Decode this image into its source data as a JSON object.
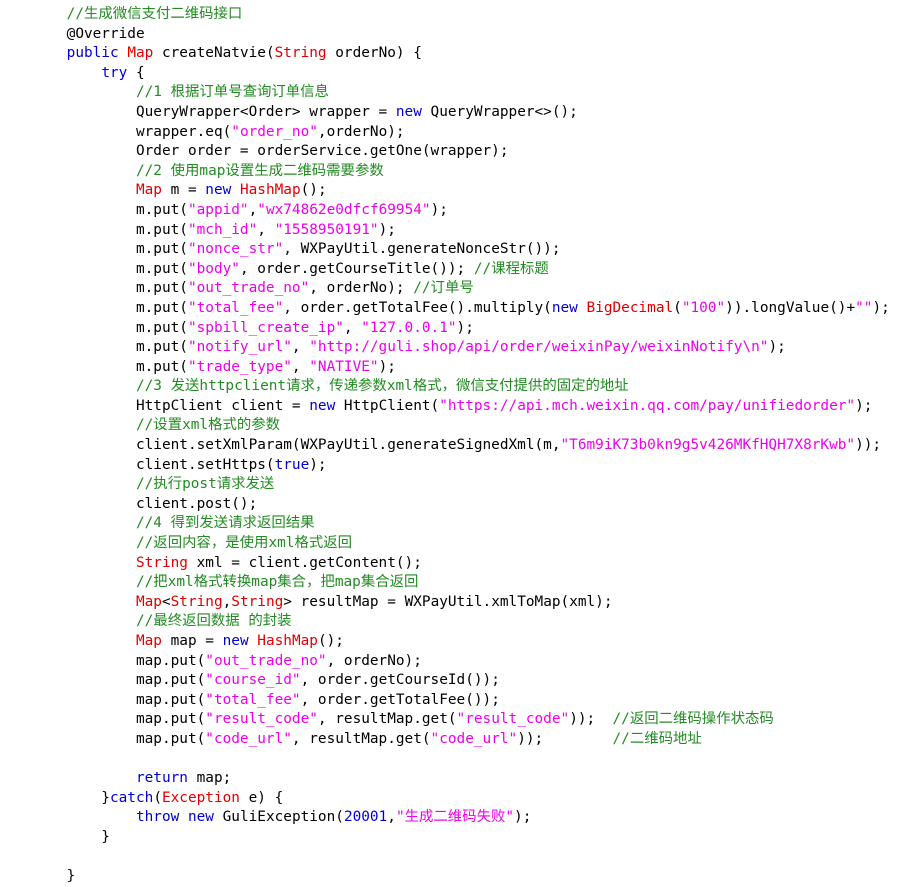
{
  "editor": {
    "language": "Java",
    "background": "#ffffff",
    "font_size_px": 14.4,
    "line_height_px": 19.6,
    "colors": {
      "plain": "#000000",
      "keyword": "#0000d0",
      "type": "#e00000",
      "string": "#ee00ee",
      "comment": "#228b22",
      "annotation": "#4a4ad0",
      "number": "#0000d0"
    }
  },
  "code": {
    "lines": [
      {
        "n": 1,
        "text": "    //生成微信支付二维码接口",
        "tokens": [
          {
            "c": "plain",
            "t": "    "
          },
          {
            "c": "comment",
            "t": "//生成微信支付二维码接口"
          }
        ]
      },
      {
        "n": 2,
        "text": "    @Override",
        "tokens": [
          {
            "c": "plain",
            "t": "    "
          },
          {
            "c": "annotation",
            "t": "@Override"
          }
        ]
      },
      {
        "n": 3,
        "text": "    public Map createNatvie(String orderNo) {",
        "tokens": [
          {
            "c": "plain",
            "t": "    "
          },
          {
            "c": "keyword",
            "t": "public"
          },
          {
            "c": "plain",
            "t": " "
          },
          {
            "c": "type",
            "t": "Map"
          },
          {
            "c": "plain",
            "t": " createNatvie("
          },
          {
            "c": "type",
            "t": "String"
          },
          {
            "c": "plain",
            "t": " orderNo) {"
          }
        ]
      },
      {
        "n": 4,
        "text": "        try {",
        "tokens": [
          {
            "c": "plain",
            "t": "        "
          },
          {
            "c": "keyword",
            "t": "try"
          },
          {
            "c": "plain",
            "t": " {"
          }
        ]
      },
      {
        "n": 5,
        "text": "            //1 根据订单号查询订单信息",
        "tokens": [
          {
            "c": "plain",
            "t": "            "
          },
          {
            "c": "comment",
            "t": "//1 根据订单号查询订单信息"
          }
        ]
      },
      {
        "n": 6,
        "text": "            QueryWrapper<Order> wrapper = new QueryWrapper<>();",
        "tokens": [
          {
            "c": "plain",
            "t": "            QueryWrapper<Order> wrapper = "
          },
          {
            "c": "keyword",
            "t": "new"
          },
          {
            "c": "plain",
            "t": " QueryWrapper<>();"
          }
        ]
      },
      {
        "n": 7,
        "text": "            wrapper.eq(\"order_no\",orderNo);",
        "tokens": [
          {
            "c": "plain",
            "t": "            wrapper.eq("
          },
          {
            "c": "string",
            "t": "\"order_no\""
          },
          {
            "c": "plain",
            "t": ",orderNo);"
          }
        ]
      },
      {
        "n": 8,
        "text": "            Order order = orderService.getOne(wrapper);",
        "tokens": [
          {
            "c": "plain",
            "t": "            Order order = orderService.getOne(wrapper);"
          }
        ]
      },
      {
        "n": 9,
        "text": "            //2 使用map设置生成二维码需要参数",
        "tokens": [
          {
            "c": "plain",
            "t": "            "
          },
          {
            "c": "comment",
            "t": "//2 使用map设置生成二维码需要参数"
          }
        ]
      },
      {
        "n": 10,
        "text": "            Map m = new HashMap();",
        "tokens": [
          {
            "c": "plain",
            "t": "            "
          },
          {
            "c": "type",
            "t": "Map"
          },
          {
            "c": "plain",
            "t": " m = "
          },
          {
            "c": "keyword",
            "t": "new"
          },
          {
            "c": "plain",
            "t": " "
          },
          {
            "c": "type",
            "t": "HashMap"
          },
          {
            "c": "plain",
            "t": "();"
          }
        ]
      },
      {
        "n": 11,
        "text": "            m.put(\"appid\",\"wx74862e0dfcf69954\");",
        "tokens": [
          {
            "c": "plain",
            "t": "            m.put("
          },
          {
            "c": "string",
            "t": "\"appid\""
          },
          {
            "c": "plain",
            "t": ","
          },
          {
            "c": "string",
            "t": "\"wx74862e0dfcf69954\""
          },
          {
            "c": "plain",
            "t": ");"
          }
        ]
      },
      {
        "n": 12,
        "text": "            m.put(\"mch_id\", \"1558950191\");",
        "tokens": [
          {
            "c": "plain",
            "t": "            m.put("
          },
          {
            "c": "string",
            "t": "\"mch_id\""
          },
          {
            "c": "plain",
            "t": ", "
          },
          {
            "c": "string",
            "t": "\"1558950191\""
          },
          {
            "c": "plain",
            "t": ");"
          }
        ]
      },
      {
        "n": 13,
        "text": "            m.put(\"nonce_str\", WXPayUtil.generateNonceStr());",
        "tokens": [
          {
            "c": "plain",
            "t": "            m.put("
          },
          {
            "c": "string",
            "t": "\"nonce_str\""
          },
          {
            "c": "plain",
            "t": ", WXPayUtil.generateNonceStr());"
          }
        ]
      },
      {
        "n": 14,
        "text": "            m.put(\"body\", order.getCourseTitle()); //课程标题",
        "tokens": [
          {
            "c": "plain",
            "t": "            m.put("
          },
          {
            "c": "string",
            "t": "\"body\""
          },
          {
            "c": "plain",
            "t": ", order.getCourseTitle()); "
          },
          {
            "c": "comment",
            "t": "//课程标题"
          }
        ]
      },
      {
        "n": 15,
        "text": "            m.put(\"out_trade_no\", orderNo); //订单号",
        "tokens": [
          {
            "c": "plain",
            "t": "            m.put("
          },
          {
            "c": "string",
            "t": "\"out_trade_no\""
          },
          {
            "c": "plain",
            "t": ", orderNo); "
          },
          {
            "c": "comment",
            "t": "//订单号"
          }
        ]
      },
      {
        "n": 16,
        "text": "            m.put(\"total_fee\", order.getTotalFee().multiply(new BigDecimal(\"100\")).longValue()+\"\");",
        "tokens": [
          {
            "c": "plain",
            "t": "            m.put("
          },
          {
            "c": "string",
            "t": "\"total_fee\""
          },
          {
            "c": "plain",
            "t": ", order.getTotalFee().multiply("
          },
          {
            "c": "keyword",
            "t": "new"
          },
          {
            "c": "plain",
            "t": " "
          },
          {
            "c": "type",
            "t": "BigDecimal"
          },
          {
            "c": "plain",
            "t": "("
          },
          {
            "c": "string",
            "t": "\"100\""
          },
          {
            "c": "plain",
            "t": ")).longValue()+"
          },
          {
            "c": "string",
            "t": "\"\""
          },
          {
            "c": "plain",
            "t": ");"
          }
        ]
      },
      {
        "n": 17,
        "text": "            m.put(\"spbill_create_ip\", \"127.0.0.1\");",
        "tokens": [
          {
            "c": "plain",
            "t": "            m.put("
          },
          {
            "c": "string",
            "t": "\"spbill_create_ip\""
          },
          {
            "c": "plain",
            "t": ", "
          },
          {
            "c": "string",
            "t": "\"127.0.0.1\""
          },
          {
            "c": "plain",
            "t": ");"
          }
        ]
      },
      {
        "n": 18,
        "text": "            m.put(\"notify_url\", \"http://guli.shop/api/order/weixinPay/weixinNotify\\n\");",
        "tokens": [
          {
            "c": "plain",
            "t": "            m.put("
          },
          {
            "c": "string",
            "t": "\"notify_url\""
          },
          {
            "c": "plain",
            "t": ", "
          },
          {
            "c": "string",
            "t": "\"http://guli.shop/api/order/weixinPay/weixinNotify\\n\""
          },
          {
            "c": "plain",
            "t": ");"
          }
        ]
      },
      {
        "n": 19,
        "text": "            m.put(\"trade_type\", \"NATIVE\");",
        "tokens": [
          {
            "c": "plain",
            "t": "            m.put("
          },
          {
            "c": "string",
            "t": "\"trade_type\""
          },
          {
            "c": "plain",
            "t": ", "
          },
          {
            "c": "string",
            "t": "\"NATIVE\""
          },
          {
            "c": "plain",
            "t": ");"
          }
        ]
      },
      {
        "n": 20,
        "text": "            //3 发送httpclient请求，传递参数xml格式，微信支付提供的固定的地址",
        "tokens": [
          {
            "c": "plain",
            "t": "            "
          },
          {
            "c": "comment",
            "t": "//3 发送httpclient请求，传递参数xml格式，微信支付提供的固定的地址"
          }
        ]
      },
      {
        "n": 21,
        "text": "            HttpClient client = new HttpClient(\"https://api.mch.weixin.qq.com/pay/unifiedorder\");",
        "tokens": [
          {
            "c": "plain",
            "t": "            HttpClient client = "
          },
          {
            "c": "keyword",
            "t": "new"
          },
          {
            "c": "plain",
            "t": " HttpClient("
          },
          {
            "c": "string",
            "t": "\"https://api.mch.weixin.qq.com/pay/unifiedorder\""
          },
          {
            "c": "plain",
            "t": ");"
          }
        ]
      },
      {
        "n": 22,
        "text": "            //设置xml格式的参数",
        "tokens": [
          {
            "c": "plain",
            "t": "            "
          },
          {
            "c": "comment",
            "t": "//设置xml格式的参数"
          }
        ]
      },
      {
        "n": 23,
        "text": "            client.setXmlParam(WXPayUtil.generateSignedXml(m,\"T6m9iK73b0kn9g5v426MKfHQH7X8rKwb\"));",
        "tokens": [
          {
            "c": "plain",
            "t": "            client.setXmlParam(WXPayUtil.generateSignedXml(m,"
          },
          {
            "c": "string",
            "t": "\"T6m9iK73b0kn9g5v426MKfHQH7X8rKwb\""
          },
          {
            "c": "plain",
            "t": "));"
          }
        ]
      },
      {
        "n": 24,
        "text": "            client.setHttps(true);",
        "tokens": [
          {
            "c": "plain",
            "t": "            client.setHttps("
          },
          {
            "c": "keyword",
            "t": "true"
          },
          {
            "c": "plain",
            "t": ");"
          }
        ]
      },
      {
        "n": 25,
        "text": "            //执行post请求发送",
        "tokens": [
          {
            "c": "plain",
            "t": "            "
          },
          {
            "c": "comment",
            "t": "//执行post请求发送"
          }
        ]
      },
      {
        "n": 26,
        "text": "            client.post();",
        "tokens": [
          {
            "c": "plain",
            "t": "            client.post();"
          }
        ]
      },
      {
        "n": 27,
        "text": "            //4 得到发送请求返回结果",
        "tokens": [
          {
            "c": "plain",
            "t": "            "
          },
          {
            "c": "comment",
            "t": "//4 得到发送请求返回结果"
          }
        ]
      },
      {
        "n": 28,
        "text": "            //返回内容，是使用xml格式返回",
        "tokens": [
          {
            "c": "plain",
            "t": "            "
          },
          {
            "c": "comment",
            "t": "//返回内容，是使用xml格式返回"
          }
        ]
      },
      {
        "n": 29,
        "text": "            String xml = client.getContent();",
        "tokens": [
          {
            "c": "plain",
            "t": "            "
          },
          {
            "c": "type",
            "t": "String"
          },
          {
            "c": "plain",
            "t": " xml = client.getContent();"
          }
        ]
      },
      {
        "n": 30,
        "text": "            //把xml格式转换map集合，把map集合返回",
        "tokens": [
          {
            "c": "plain",
            "t": "            "
          },
          {
            "c": "comment",
            "t": "//把xml格式转换map集合，把map集合返回"
          }
        ]
      },
      {
        "n": 31,
        "text": "            Map<String,String> resultMap = WXPayUtil.xmlToMap(xml);",
        "tokens": [
          {
            "c": "plain",
            "t": "            "
          },
          {
            "c": "type",
            "t": "Map"
          },
          {
            "c": "plain",
            "t": "<"
          },
          {
            "c": "type",
            "t": "String"
          },
          {
            "c": "plain",
            "t": ","
          },
          {
            "c": "type",
            "t": "String"
          },
          {
            "c": "plain",
            "t": "> resultMap = WXPayUtil.xmlToMap(xml);"
          }
        ]
      },
      {
        "n": 32,
        "text": "            //最终返回数据 的封装",
        "tokens": [
          {
            "c": "plain",
            "t": "            "
          },
          {
            "c": "comment",
            "t": "//最终返回数据 的封装"
          }
        ]
      },
      {
        "n": 33,
        "text": "            Map map = new HashMap();",
        "tokens": [
          {
            "c": "plain",
            "t": "            "
          },
          {
            "c": "type",
            "t": "Map"
          },
          {
            "c": "plain",
            "t": " map = "
          },
          {
            "c": "keyword",
            "t": "new"
          },
          {
            "c": "plain",
            "t": " "
          },
          {
            "c": "type",
            "t": "HashMap"
          },
          {
            "c": "plain",
            "t": "();"
          }
        ]
      },
      {
        "n": 34,
        "text": "            map.put(\"out_trade_no\", orderNo);",
        "tokens": [
          {
            "c": "plain",
            "t": "            map.put("
          },
          {
            "c": "string",
            "t": "\"out_trade_no\""
          },
          {
            "c": "plain",
            "t": ", orderNo);"
          }
        ]
      },
      {
        "n": 35,
        "text": "            map.put(\"course_id\", order.getCourseId());",
        "tokens": [
          {
            "c": "plain",
            "t": "            map.put("
          },
          {
            "c": "string",
            "t": "\"course_id\""
          },
          {
            "c": "plain",
            "t": ", order.getCourseId());"
          }
        ]
      },
      {
        "n": 36,
        "text": "            map.put(\"total_fee\", order.getTotalFee());",
        "tokens": [
          {
            "c": "plain",
            "t": "            map.put("
          },
          {
            "c": "string",
            "t": "\"total_fee\""
          },
          {
            "c": "plain",
            "t": ", order.getTotalFee());"
          }
        ]
      },
      {
        "n": 37,
        "text": "            map.put(\"result_code\", resultMap.get(\"result_code\"));  //返回二维码操作状态码",
        "tokens": [
          {
            "c": "plain",
            "t": "            map.put("
          },
          {
            "c": "string",
            "t": "\"result_code\""
          },
          {
            "c": "plain",
            "t": ", resultMap.get("
          },
          {
            "c": "string",
            "t": "\"result_code\""
          },
          {
            "c": "plain",
            "t": "));  "
          },
          {
            "c": "comment",
            "t": "//返回二维码操作状态码"
          }
        ]
      },
      {
        "n": 38,
        "text": "            map.put(\"code_url\", resultMap.get(\"code_url\"));        //二维码地址",
        "tokens": [
          {
            "c": "plain",
            "t": "            map.put("
          },
          {
            "c": "string",
            "t": "\"code_url\""
          },
          {
            "c": "plain",
            "t": ", resultMap.get("
          },
          {
            "c": "string",
            "t": "\"code_url\""
          },
          {
            "c": "plain",
            "t": "));        "
          },
          {
            "c": "comment",
            "t": "//二维码地址"
          }
        ]
      },
      {
        "n": 39,
        "text": "",
        "tokens": []
      },
      {
        "n": 40,
        "text": "            return map;",
        "tokens": [
          {
            "c": "plain",
            "t": "            "
          },
          {
            "c": "keyword",
            "t": "return"
          },
          {
            "c": "plain",
            "t": " map;"
          }
        ]
      },
      {
        "n": 41,
        "text": "        }catch(Exception e) {",
        "tokens": [
          {
            "c": "plain",
            "t": "        }"
          },
          {
            "c": "keyword",
            "t": "catch"
          },
          {
            "c": "plain",
            "t": "("
          },
          {
            "c": "type",
            "t": "Exception"
          },
          {
            "c": "plain",
            "t": " e) {"
          }
        ]
      },
      {
        "n": 42,
        "text": "            throw new GuliException(20001,\"生成二维码失败\");",
        "tokens": [
          {
            "c": "plain",
            "t": "            "
          },
          {
            "c": "keyword",
            "t": "throw"
          },
          {
            "c": "plain",
            "t": " "
          },
          {
            "c": "keyword",
            "t": "new"
          },
          {
            "c": "plain",
            "t": " GuliException("
          },
          {
            "c": "number",
            "t": "20001"
          },
          {
            "c": "plain",
            "t": ","
          },
          {
            "c": "string",
            "t": "\"生成二维码失败\""
          },
          {
            "c": "plain",
            "t": ");"
          }
        ]
      },
      {
        "n": 43,
        "text": "        }",
        "tokens": [
          {
            "c": "plain",
            "t": "        }"
          }
        ]
      },
      {
        "n": 44,
        "text": "",
        "tokens": []
      },
      {
        "n": 45,
        "text": "    }",
        "tokens": [
          {
            "c": "plain",
            "t": "    }"
          }
        ]
      }
    ]
  }
}
